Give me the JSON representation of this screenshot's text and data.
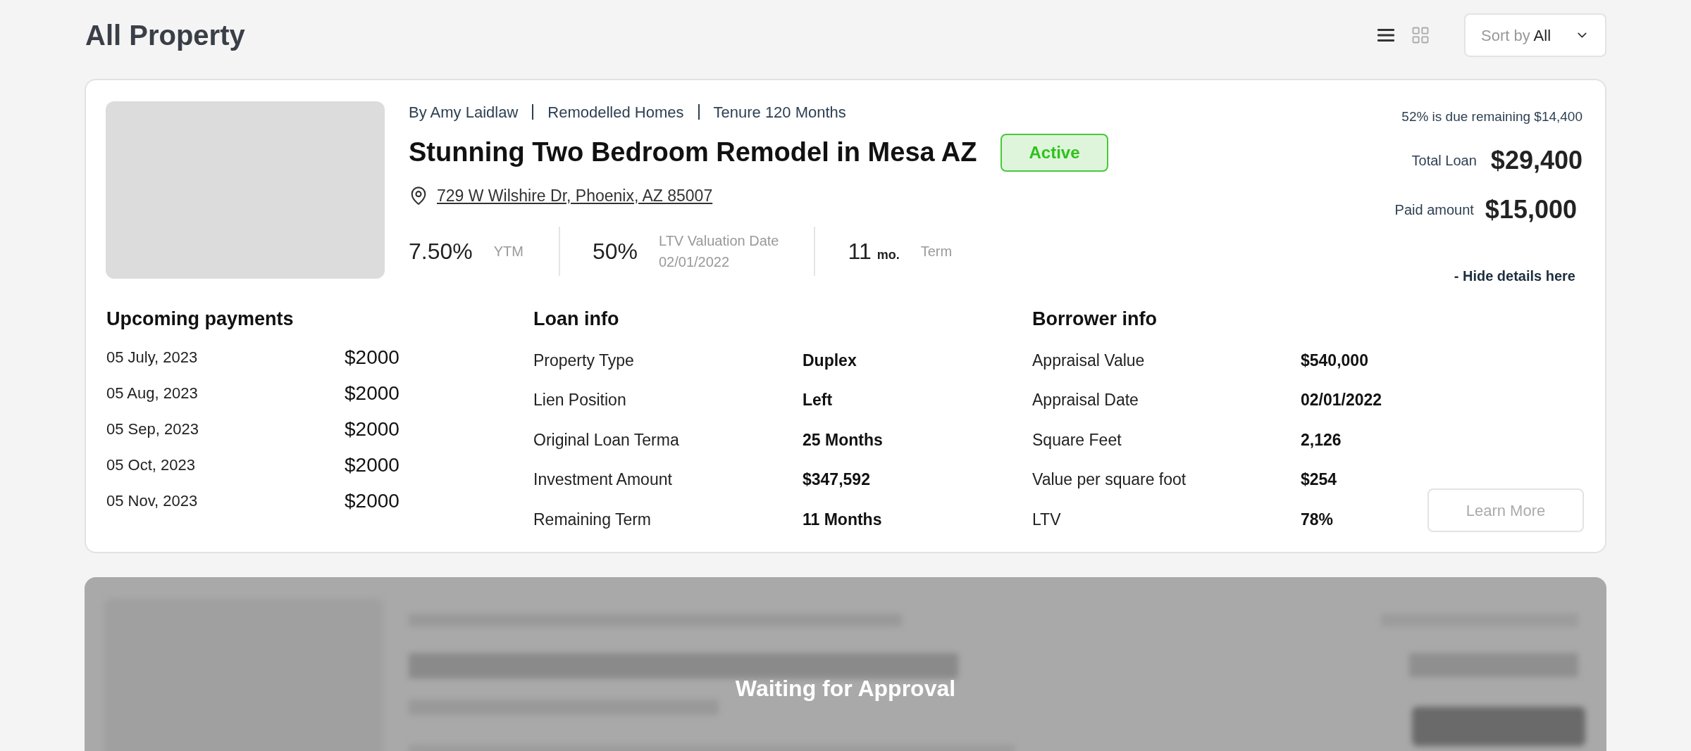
{
  "header": {
    "title": "All Property",
    "view_toggle": [
      {
        "kind": "list",
        "selected": true
      },
      {
        "kind": "grid",
        "selected": false
      }
    ],
    "sort": {
      "label": "Sort by",
      "value": "All"
    }
  },
  "cards": [
    {
      "kind": "expanded",
      "meta": [
        "By Amy Laidlaw",
        "Remodelled Homes",
        "Tenure 120 Months"
      ],
      "title": "Stunning Two Bedroom Remodel in Mesa AZ",
      "status": "Active",
      "address": "729 W Wilshire Dr, Phoenix, AZ 85007",
      "stats": [
        {
          "value": "7.50%",
          "caption": "YTM"
        },
        {
          "value": "50%",
          "caption": "LTV Valuation Date",
          "sub": "02/01/2022"
        },
        {
          "value": "11",
          "unit": "mo.",
          "caption": "Term"
        }
      ],
      "due_note": "52% is due remaining $14,400",
      "total_loan": {
        "label": "Total Loan",
        "value": "$29,400"
      },
      "paid": {
        "label": "Paid amount",
        "value": "$15,000"
      },
      "toggle_link": "- Hide details here",
      "payments": {
        "title": "Upcoming payments",
        "rows": [
          {
            "date": "05 July, 2023",
            "amount": "$2000"
          },
          {
            "date": "05 Aug, 2023",
            "amount": "$2000"
          },
          {
            "date": "05 Sep, 2023",
            "amount": "$2000"
          },
          {
            "date": "05 Oct, 2023",
            "amount": "$2000"
          },
          {
            "date": "05 Nov, 2023",
            "amount": "$2000"
          }
        ]
      },
      "loan_info": {
        "title": "Loan info",
        "rows": [
          {
            "label": "Property Type",
            "value": "Duplex"
          },
          {
            "label": "Lien Position",
            "value": "Left"
          },
          {
            "label": "Original Loan Terma",
            "value": "25 Months"
          },
          {
            "label": "Investment Amount",
            "value": "$347,592"
          },
          {
            "label": "Remaining Term",
            "value": "11 Months"
          }
        ]
      },
      "borrower_info": {
        "title": "Borrower info",
        "rows": [
          {
            "label": "Appraisal Value",
            "value": "$540,000"
          },
          {
            "label": "Appraisal Date",
            "value": "02/01/2022"
          },
          {
            "label": "Square Feet",
            "value": "2,126"
          },
          {
            "label": "Value per square foot",
            "value": "$254"
          },
          {
            "label": "LTV",
            "value": "78%"
          }
        ]
      },
      "button": {
        "label": "Learn More",
        "disabled": true
      }
    },
    {
      "kind": "pending",
      "overlay": "Waiting for Approval"
    }
  ]
}
